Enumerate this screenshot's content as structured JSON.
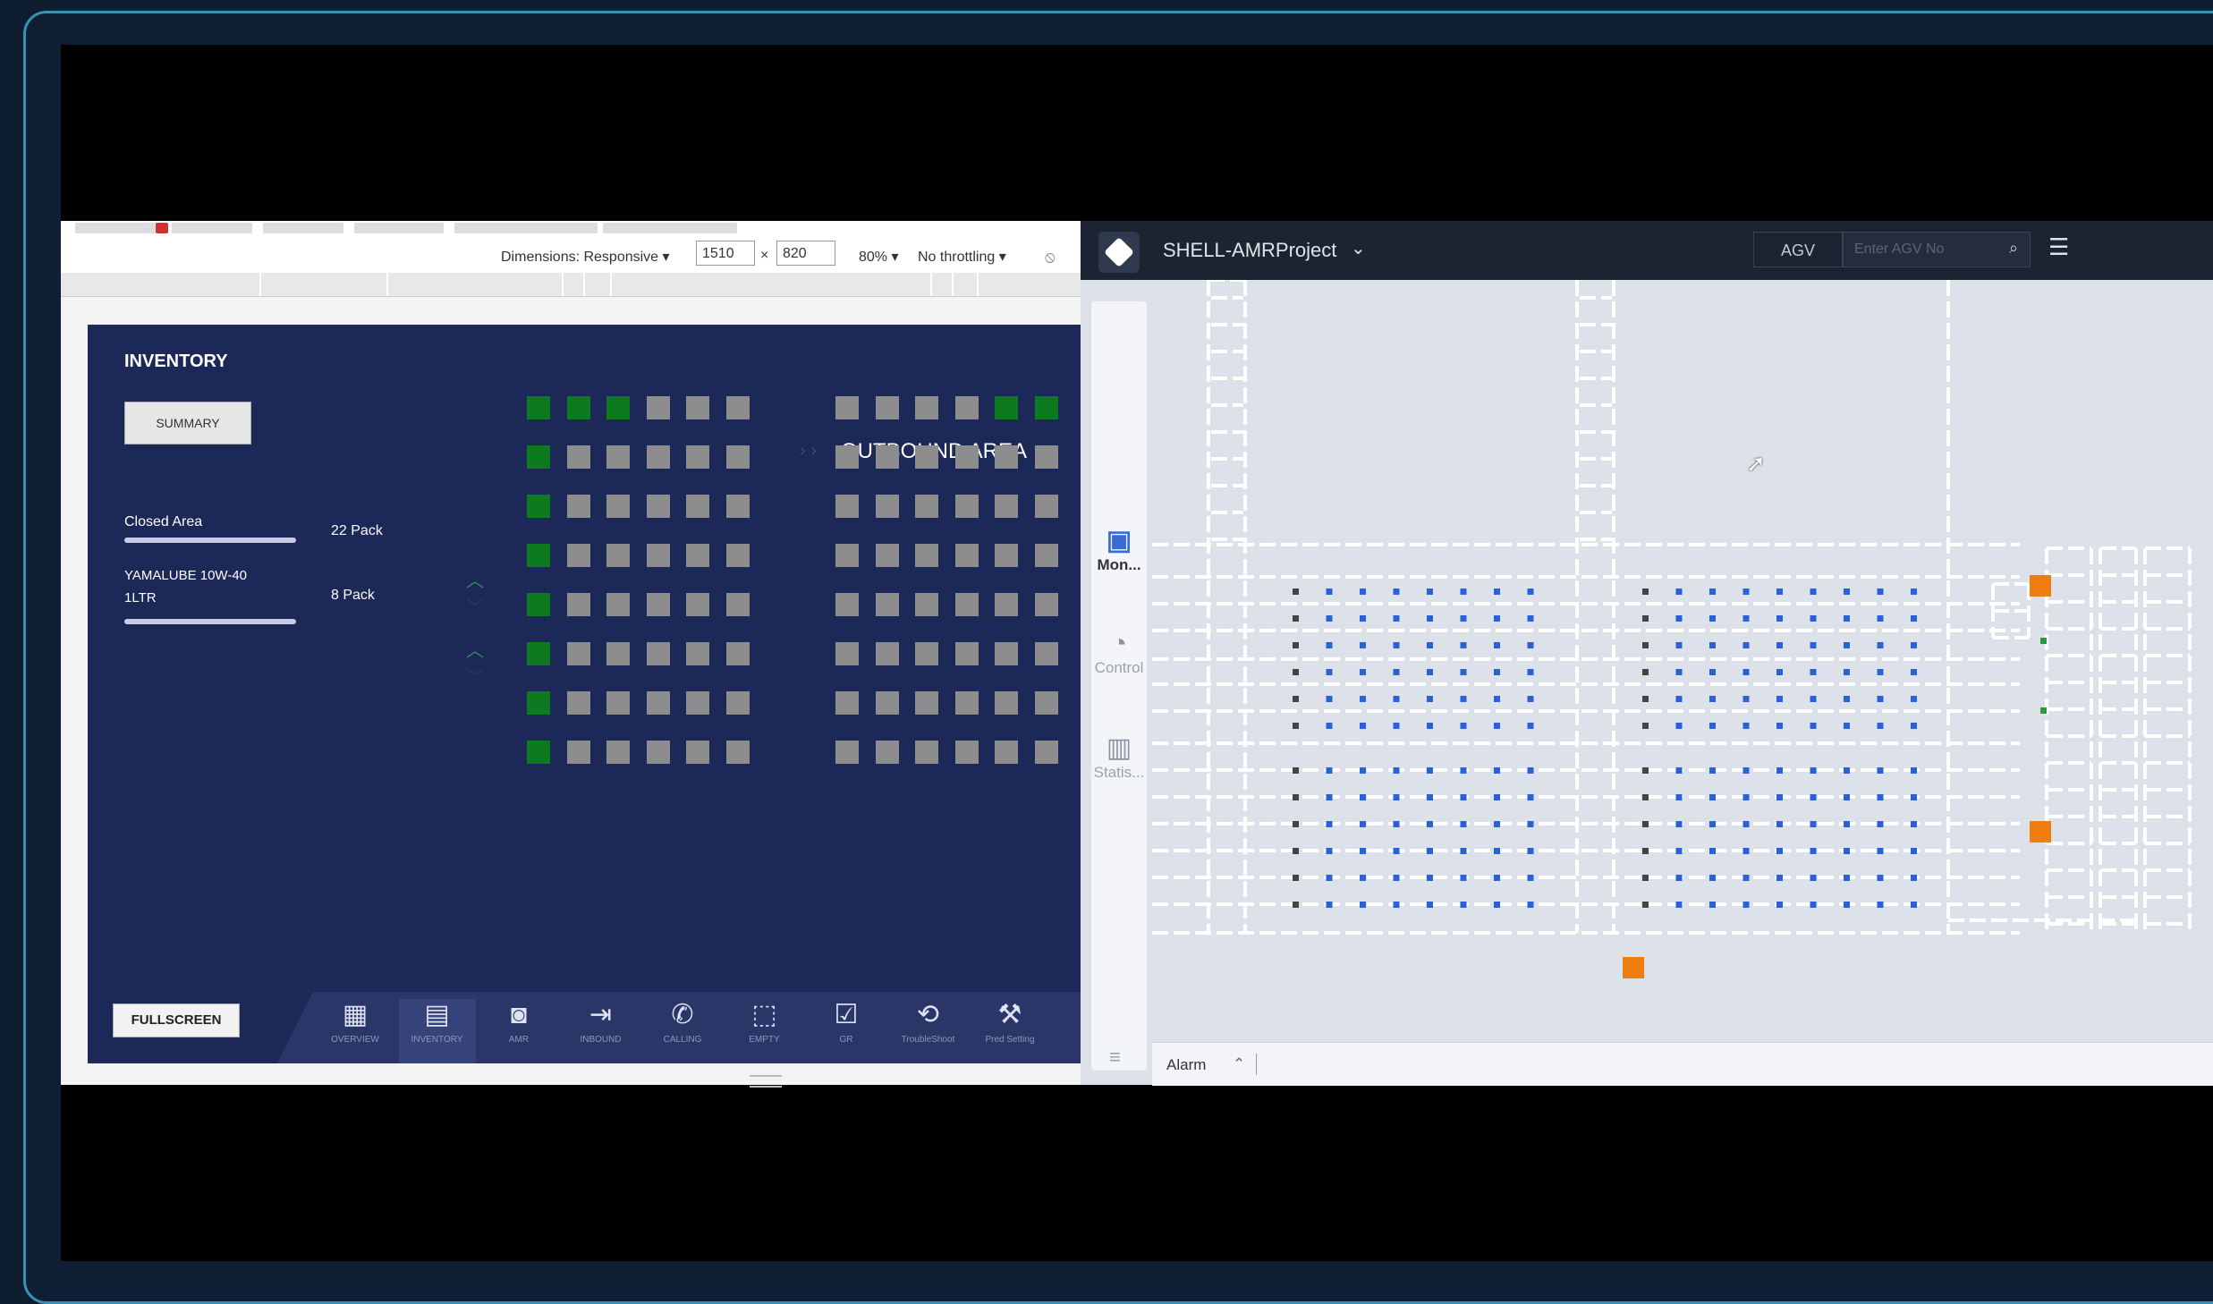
{
  "devtools": {
    "dimensions_label": "Dimensions: Responsive ▾",
    "width_value": "1510",
    "times": "×",
    "height_value": "820",
    "zoom": "80% ▾",
    "throttling": "No throttling ▾"
  },
  "inventory": {
    "title": "INVENTORY",
    "summary_button": "SUMMARY",
    "items": [
      {
        "name": "Closed Area",
        "qty": "22 Pack"
      },
      {
        "name_line1": "YAMALUBE 10W-40",
        "name_line2": "1LTR",
        "qty": "8 Pack"
      }
    ],
    "outbound_title": "OUTBOUND AREA",
    "fullscreen_button": "FULLSCREEN",
    "colors": {
      "green": "#0e7a1f",
      "gray": "#8d8d8d",
      "bg": "#1c2857"
    },
    "grid_left": [
      [
        "g",
        "g",
        "g",
        "x",
        "x",
        "x"
      ],
      [
        "g",
        "x",
        "x",
        "x",
        "x",
        "x"
      ],
      [
        "g",
        "x",
        "x",
        "x",
        "x",
        "x"
      ],
      [
        "g",
        "x",
        "x",
        "x",
        "x",
        "x"
      ],
      [
        "g",
        "x",
        "x",
        "x",
        "x",
        "x"
      ],
      [
        "g",
        "x",
        "x",
        "x",
        "x",
        "x"
      ],
      [
        "g",
        "x",
        "x",
        "x",
        "x",
        "x"
      ],
      [
        "g",
        "x",
        "x",
        "x",
        "x",
        "x"
      ]
    ],
    "grid_right": [
      [
        "x",
        "x",
        "x",
        "x",
        "g",
        "g"
      ],
      [
        "x",
        "x",
        "x",
        "x",
        "x",
        "x"
      ],
      [
        "x",
        "x",
        "x",
        "x",
        "x",
        "x"
      ],
      [
        "x",
        "x",
        "x",
        "x",
        "x",
        "x"
      ],
      [
        "x",
        "x",
        "x",
        "x",
        "x",
        "x"
      ],
      [
        "x",
        "x",
        "x",
        "x",
        "x",
        "x"
      ],
      [
        "x",
        "x",
        "x",
        "x",
        "x",
        "x"
      ],
      [
        "x",
        "x",
        "x",
        "x",
        "x",
        "x"
      ]
    ]
  },
  "tabs": [
    {
      "icon": "overview-icon",
      "glyph": "▦",
      "label": "OVERVIEW"
    },
    {
      "icon": "inventory-icon",
      "glyph": "▤",
      "label": "INVENTORY",
      "active": true
    },
    {
      "icon": "amr-icon",
      "glyph": "◙",
      "label": "AMR"
    },
    {
      "icon": "inbound-icon",
      "glyph": "⇥",
      "label": "INBOUND"
    },
    {
      "icon": "calling-icon",
      "glyph": "✆",
      "label": "CALLING"
    },
    {
      "icon": "empty-icon",
      "glyph": "⬚",
      "label": "EMPTY"
    },
    {
      "icon": "gr-icon",
      "glyph": "☑",
      "label": "GR"
    },
    {
      "icon": "troubleshoot-icon",
      "glyph": "⟲",
      "label": "TroubleShoot"
    },
    {
      "icon": "pred-setting-icon",
      "glyph": "⚒",
      "label": "Pred Setting"
    }
  ],
  "amr": {
    "project": "SHELL-AMRProject",
    "agv_select": "AGV",
    "agv_placeholder": "Enter AGV No",
    "side": [
      {
        "icon": "monitor-icon",
        "glyph": "▣",
        "label": "Mon...",
        "active": true
      },
      {
        "icon": "control-icon",
        "glyph": "◔",
        "label": "Control"
      },
      {
        "icon": "statistics-icon",
        "glyph": "▥",
        "label": "Statis..."
      }
    ],
    "alarm_label": "Alarm",
    "agv_color": "#f07d10"
  }
}
